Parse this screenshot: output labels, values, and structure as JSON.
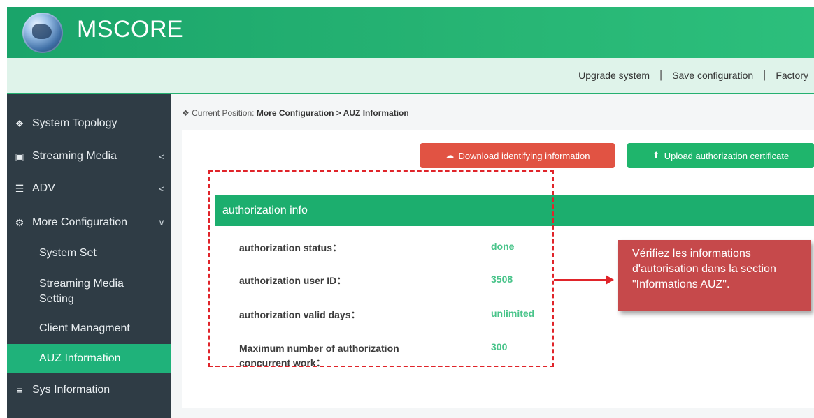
{
  "header": {
    "app_title": "MSCORE",
    "logo": "globe-logo"
  },
  "toolbar": {
    "upgrade": "Upgrade system",
    "separator": "|",
    "save": "Save configuration",
    "factory": "Factory"
  },
  "sidebar": {
    "items": [
      {
        "label": "System Topology",
        "icon": "home-icon",
        "glyph": "❖"
      },
      {
        "label": "Streaming Media",
        "icon": "film-icon",
        "glyph": "▣",
        "arrow": "<"
      },
      {
        "label": "ADV",
        "icon": "list-icon",
        "glyph": "☰",
        "arrow": "<"
      },
      {
        "label": "More Configuration",
        "icon": "cogs-icon",
        "glyph": "⚙",
        "arrow": "∨"
      },
      {
        "label": "Sys Information",
        "icon": "server-icon",
        "glyph": "≡"
      }
    ],
    "sub_items": [
      {
        "label": "System Set"
      },
      {
        "label": "Streaming Media Setting"
      },
      {
        "label": "Client Managment"
      },
      {
        "label": "AUZ Information",
        "active": true
      }
    ]
  },
  "breadcrumb": {
    "prefix": "Current Position:",
    "path": "More Configuration  > AUZ Information"
  },
  "buttons": {
    "download": "Download identifying information",
    "upload": "Upload authorization certificate"
  },
  "info": {
    "header": "authorization info",
    "rows": [
      {
        "label": "authorization status：",
        "value": "done"
      },
      {
        "label": "authorization user ID：",
        "value": "3508"
      },
      {
        "label": "authorization valid days：",
        "value": "unlimited"
      },
      {
        "label": "Maximum number of authorization concurrent work：",
        "value": "300"
      }
    ]
  },
  "callout": {
    "text": "Vérifiez les informations d'autorisation dans la section \"Informations AUZ\"."
  },
  "colors": {
    "brand_green": "#1cae6e",
    "sidebar_bg": "#2f3c45",
    "download_red": "#e15343",
    "highlight_red": "#e0242a",
    "callout_bg": "#c6494b"
  }
}
